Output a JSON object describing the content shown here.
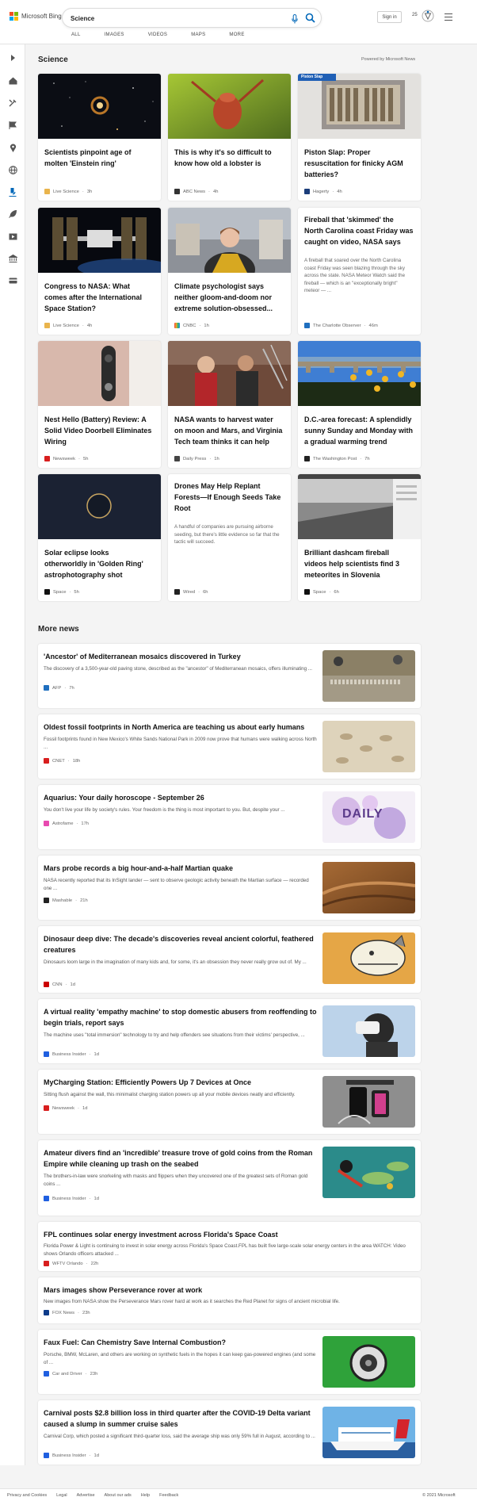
{
  "header": {
    "brand": "Microsoft Bing",
    "search_value": "Science",
    "tabs": [
      "ALL",
      "IMAGES",
      "VIDEOS",
      "MAPS",
      "MORE"
    ],
    "signin_label": "Sign in",
    "points": "25"
  },
  "colors": {
    "ms_red": "#f25022",
    "ms_green": "#7fba00",
    "ms_blue": "#00a4ef",
    "ms_yellow": "#ffb900",
    "bing_blue": "#0067b8"
  },
  "rail": {
    "icons": [
      "expand-icon",
      "home-icon",
      "tools-icon",
      "flag-icon",
      "location-icon",
      "globe-icon",
      "microscope-icon",
      "rocket-icon",
      "video-icon",
      "bank-icon",
      "card-icon"
    ]
  },
  "main": {
    "section_title": "Science",
    "powered_by": "Powered by Microsoft News",
    "cards": [
      {
        "title": "Scientists pinpoint age of molten 'Einstein ring'",
        "source": "Live Science",
        "age": "3h"
      },
      {
        "title": "This is why it's so difficult to know how old a lobster is",
        "source": "ABC News",
        "age": "4h"
      },
      {
        "title": "Piston Slap: Proper resuscitation for finicky AGM batteries?",
        "source": "Hagerty",
        "age": "4h",
        "image_tag": "Piston Slap"
      },
      {
        "title": "Congress to NASA: What comes after the International Space Station?",
        "source": "Live Science",
        "age": "4h"
      },
      {
        "title": "Climate psychologist says neither gloom-and-doom nor extreme solution-obsessed...",
        "source": "CNBC",
        "age": "1h"
      },
      {
        "title": "Fireball that 'skimmed' the North Carolina coast Friday was caught on video, NASA says",
        "snippet": "A fireball that soared over the North Carolina coast Friday was seen blazing through the sky across the state. NASA Meteor Watch said the fireball — which is an \"exceptionally bright\" meteor — ...",
        "source": "The Charlotte Observer",
        "age": "46m"
      },
      {
        "title": "Nest Hello (Battery) Review: A Solid Video Doorbell Eliminates Wiring",
        "source": "Newsweek",
        "age": "5h"
      },
      {
        "title": "NASA wants to harvest water on moon and Mars, and Virginia Tech team thinks it can help",
        "source": "Daily Press",
        "age": "1h"
      },
      {
        "title": "D.C.-area forecast: A splendidly sunny Sunday and Monday with a gradual warming trend",
        "source": "The Washington Post",
        "age": "7h"
      },
      {
        "title": "Solar eclipse looks otherworldly in 'Golden Ring' astrophotography shot",
        "source": "Space",
        "age": "5h"
      },
      {
        "title": "Drones May Help Replant Forests—If Enough Seeds Take Root",
        "snippet": "A handful of companies are pursuing airborne seeding, but there's little evidence so far that the tactic will succeed.",
        "source": "Wired",
        "age": "6h"
      },
      {
        "title": "Brilliant dashcam fireball videos help scientists find 3 meteorites in Slovenia",
        "source": "Space",
        "age": "6h"
      }
    ]
  },
  "more_news": {
    "title": "More news",
    "items": [
      {
        "title": "'Ancestor' of Mediterranean mosaics discovered in Turkey",
        "snippet": "The discovery of a 3,500-year-old paving stone, described as the \"ancestor\" of Mediterranean mosaics, offers illuminating ...",
        "source": "AFP",
        "age": "7h"
      },
      {
        "title": "Oldest fossil footprints in North America are teaching us about early humans",
        "snippet": "Fossil footprints found in New Mexico's White Sands National Park in 2009 now prove that humans were walking across North ...",
        "source": "CNET",
        "age": "18h"
      },
      {
        "title": "Aquarius: Your daily horoscope - September 26",
        "snippet": "You don't live your life by society's rules. Your freedom is the thing is most important to you. But, despite your ...",
        "source": "Astrofame",
        "age": "17h",
        "image_text": "DAILY"
      },
      {
        "title": "Mars probe records a big hour-and-a-half Martian quake",
        "snippet": "NASA recently reported that its InSight lander — sent to observe geologic activity beneath the Martian surface — recorded one ...",
        "source": "Mashable",
        "age": "21h"
      },
      {
        "title": "Dinosaur deep dive: The decade's discoveries reveal ancient colorful, feathered creatures",
        "snippet": "Dinosaurs loom large in the imagination of many kids and, for some, it's an obsession they never really grow out of. My ...",
        "source": "CNN",
        "age": "1d"
      },
      {
        "title": "A virtual reality 'empathy machine' to stop domestic abusers from reoffending to begin trials, report says",
        "snippet": "The machine uses \"total immersion\" technology to try and help offenders see situations from their victims' perspective, ...",
        "source": "Business Insider",
        "age": "1d"
      },
      {
        "title": "MyCharging Station: Efficiently Powers Up 7 Devices at Once",
        "snippet": "Sitting flush against the wall, this minimalist charging station powers up all your mobile devices neatly and efficiently.",
        "source": "Newsweek",
        "age": "1d"
      },
      {
        "title": "Amateur divers find an 'incredible' treasure trove of gold coins from the Roman Empire while cleaning up trash on the seabed",
        "snippet": "The brothers-in-law were snorkeling with masks and flippers when they uncovered one of the greatest sets of Roman gold coins ...",
        "source": "Business Insider",
        "age": "1d"
      },
      {
        "title": "FPL continues solar energy investment across Florida's Space Coast",
        "snippet": "Florida Power & Light is continuing to invest in solar energy across Florida's Space Coast.FPL has built five large-scale solar energy centers in the area WATCH: Video shows Orlando officers attacked ...",
        "source": "WFTV Orlando",
        "age": "22h"
      },
      {
        "title": "Mars images show Perseverance rover at work",
        "snippet": "New images from NASA show the Perseverance Mars rover hard at work as it searches the Red Planet for signs of ancient microbial life.",
        "source": "FOX News",
        "age": "23h"
      },
      {
        "title": "Faux Fuel: Can Chemistry Save Internal Combustion?",
        "snippet": "Porsche, BMW, McLaren, and others are working on synthetic fuels in the hopes it can keep gas-powered engines (and some of ...",
        "source": "Car and Driver",
        "age": "23h"
      },
      {
        "title": "Carnival posts $2.8 billion loss in third quarter after the COVID-19 Delta variant caused a slump in summer cruise sales",
        "snippet": "Carnival Corp, which posted a significant third-quarter loss, said the average ship was only 59% full in August, according to ...",
        "source": "Business Insider",
        "age": "1d"
      }
    ]
  },
  "footer": {
    "links": [
      "Privacy and Cookies",
      "Legal",
      "Advertise",
      "About our ads",
      "Help",
      "Feedback"
    ],
    "copyright": "© 2021 Microsoft"
  }
}
